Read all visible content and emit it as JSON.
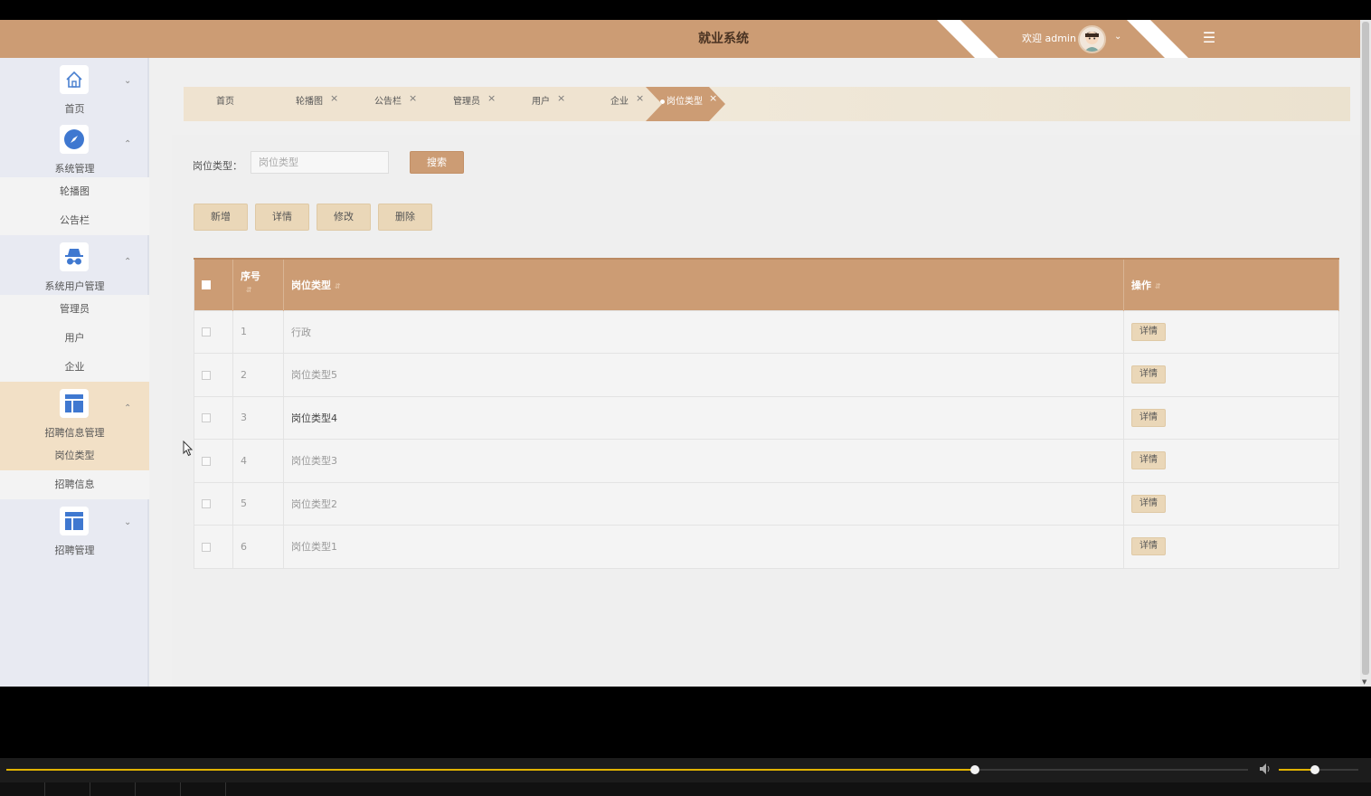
{
  "header": {
    "title": "就业系统",
    "welcome": "欢迎 admin",
    "user_menu_icon": "chevron-down-icon",
    "menu_icon": "hamburger-menu-icon",
    "bg_color": "#cc9c74"
  },
  "sidebar": {
    "groups": [
      {
        "label": "首页",
        "icon": "home-icon",
        "expanded": false,
        "items": []
      },
      {
        "label": "系统管理",
        "icon": "compass-icon",
        "expanded": true,
        "items": [
          "轮播图",
          "公告栏"
        ]
      },
      {
        "label": "系统用户管理",
        "icon": "incognito-icon",
        "expanded": true,
        "items": [
          "管理员",
          "用户",
          "企业"
        ]
      },
      {
        "label": "招聘信息管理",
        "icon": "layout-icon",
        "expanded": true,
        "items": [
          "岗位类型",
          "招聘信息"
        ]
      },
      {
        "label": "招聘管理",
        "icon": "layout-icon",
        "expanded": false,
        "items": []
      }
    ],
    "active_item": "岗位类型"
  },
  "tabs": [
    {
      "label": "首页",
      "closable": false
    },
    {
      "label": "轮播图",
      "closable": true
    },
    {
      "label": "公告栏",
      "closable": true
    },
    {
      "label": "管理员",
      "closable": true
    },
    {
      "label": "用户",
      "closable": true
    },
    {
      "label": "企业",
      "closable": true
    },
    {
      "label": "岗位类型",
      "closable": true,
      "active": true
    }
  ],
  "search": {
    "label": "岗位类型：",
    "placeholder": "岗位类型",
    "button": "搜索"
  },
  "actions": {
    "add": "新增",
    "detail": "详情",
    "edit": "修改",
    "delete": "删除"
  },
  "table": {
    "columns": {
      "index": "序号",
      "type": "岗位类型",
      "ops": "操作"
    },
    "rows": [
      {
        "index": "1",
        "type": "行政",
        "op": "详情"
      },
      {
        "index": "2",
        "type": "岗位类型5",
        "op": "详情"
      },
      {
        "index": "3",
        "type": "岗位类型4",
        "op": "详情"
      },
      {
        "index": "4",
        "type": "岗位类型3",
        "op": "详情"
      },
      {
        "index": "5",
        "type": "岗位类型2",
        "op": "详情"
      },
      {
        "index": "6",
        "type": "岗位类型1",
        "op": "详情"
      }
    ]
  },
  "player": {
    "progress": 0.78,
    "volume": 0.45,
    "accent_color": "#e2b300"
  }
}
